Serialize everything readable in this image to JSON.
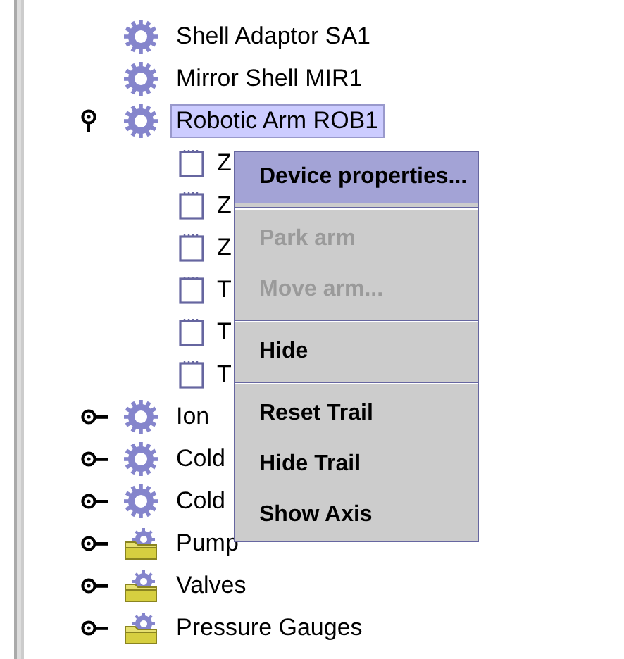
{
  "tree": [
    {
      "label": "Shell Adaptor SA1",
      "kind": "device",
      "selected": false
    },
    {
      "label": "Mirror Shell MIR1",
      "kind": "device",
      "selected": false
    },
    {
      "label": "Robotic Arm ROB1",
      "kind": "device",
      "selected": true,
      "expanded": true,
      "children": [
        {
          "label": "Z",
          "kind": "point",
          "selected": false
        },
        {
          "label": "Z",
          "kind": "point",
          "selected": false
        },
        {
          "label": "Z",
          "kind": "point",
          "selected": false
        },
        {
          "label": "T",
          "kind": "point",
          "selected": false
        },
        {
          "label": "T",
          "kind": "point",
          "selected": false
        },
        {
          "label": "T",
          "kind": "point",
          "selected": false
        }
      ]
    },
    {
      "label": "Ion",
      "kind": "device",
      "selected": false,
      "expanded": false
    },
    {
      "label": "Cold",
      "kind": "device",
      "selected": false,
      "expanded": false
    },
    {
      "label": "Cold",
      "kind": "device",
      "selected": false,
      "expanded": false
    },
    {
      "label": "Pump",
      "kind": "group",
      "selected": false,
      "expanded": false
    },
    {
      "label": "Valves",
      "kind": "group",
      "selected": false,
      "expanded": false
    },
    {
      "label": "Pressure Gauges",
      "kind": "group",
      "selected": false,
      "expanded": false
    }
  ],
  "context_menu": [
    {
      "kind": "item",
      "label": "Device properties...",
      "selected": true,
      "disabled": false
    },
    {
      "kind": "separator"
    },
    {
      "kind": "item",
      "label": "Park arm",
      "selected": false,
      "disabled": true
    },
    {
      "kind": "item",
      "label": "Move arm...",
      "selected": false,
      "disabled": true
    },
    {
      "kind": "separator"
    },
    {
      "kind": "item",
      "label": "Hide",
      "selected": false,
      "disabled": false
    },
    {
      "kind": "separator"
    },
    {
      "kind": "item",
      "label": "Reset Trail",
      "selected": false,
      "disabled": false
    },
    {
      "kind": "item",
      "label": "Hide Trail",
      "selected": false,
      "disabled": false
    },
    {
      "kind": "item",
      "label": "Show Axis",
      "selected": false,
      "disabled": false
    }
  ]
}
